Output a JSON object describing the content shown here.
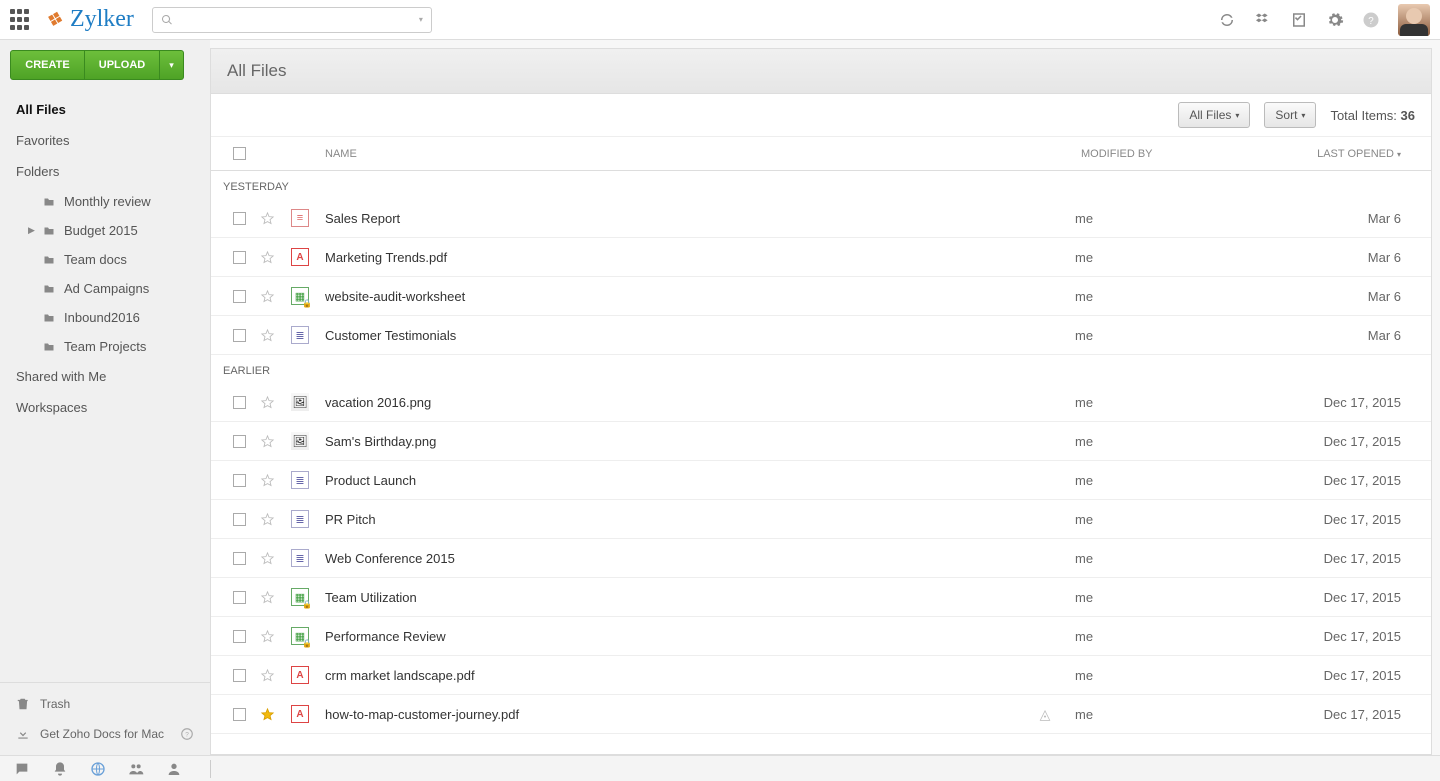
{
  "brand": {
    "name": "Zylker"
  },
  "search": {
    "placeholder": ""
  },
  "sidebar": {
    "create": "CREATE",
    "upload": "UPLOAD",
    "items": [
      {
        "label": "All Files",
        "active": true
      },
      {
        "label": "Favorites"
      },
      {
        "label": "Folders"
      }
    ],
    "folders": [
      {
        "label": "Monthly review"
      },
      {
        "label": "Budget 2015",
        "expandable": true
      },
      {
        "label": "Team docs"
      },
      {
        "label": "Ad Campaigns"
      },
      {
        "label": "Inbound2016"
      },
      {
        "label": "Team Projects"
      }
    ],
    "after": [
      {
        "label": "Shared with Me"
      },
      {
        "label": "Workspaces"
      }
    ],
    "bottom": {
      "trash": "Trash",
      "mac": "Get Zoho Docs for Mac"
    }
  },
  "main": {
    "title": "All Files",
    "toolbar": {
      "filter": "All Files",
      "sort": "Sort",
      "total_label": "Total Items:",
      "total_count": "36"
    },
    "columns": {
      "name": "NAME",
      "modified": "MODIFIED BY",
      "opened": "LAST OPENED"
    },
    "groups": [
      {
        "label": "YESTERDAY",
        "rows": [
          {
            "icon": "doc",
            "name": "Sales Report",
            "mod": "me",
            "opened": "Mar 6"
          },
          {
            "icon": "pdf",
            "name": "Marketing Trends.pdf",
            "mod": "me",
            "opened": "Mar 6"
          },
          {
            "icon": "sheetl",
            "name": "website-audit-worksheet",
            "mod": "me",
            "opened": "Mar 6"
          },
          {
            "icon": "docs",
            "name": "Customer Testimonials",
            "mod": "me",
            "opened": "Mar 6"
          }
        ]
      },
      {
        "label": "EARLIER",
        "rows": [
          {
            "icon": "img",
            "name": "vacation 2016.png",
            "mod": "me",
            "opened": "Dec 17, 2015"
          },
          {
            "icon": "img",
            "name": "Sam's Birthday.png",
            "mod": "me",
            "opened": "Dec 17, 2015"
          },
          {
            "icon": "docs",
            "name": "Product Launch",
            "mod": "me",
            "opened": "Dec 17, 2015"
          },
          {
            "icon": "docs",
            "name": "PR Pitch",
            "mod": "me",
            "opened": "Dec 17, 2015"
          },
          {
            "icon": "docs",
            "name": "Web Conference 2015",
            "mod": "me",
            "opened": "Dec 17, 2015"
          },
          {
            "icon": "sheetl",
            "name": "Team Utilization",
            "mod": "me",
            "opened": "Dec 17, 2015"
          },
          {
            "icon": "sheetl",
            "name": "Performance Review",
            "mod": "me",
            "opened": "Dec 17, 2015"
          },
          {
            "icon": "pdf",
            "name": "crm market landscape.pdf",
            "mod": "me",
            "opened": "Dec 17, 2015"
          },
          {
            "icon": "pdf",
            "name": "how-to-map-customer-journey.pdf",
            "fav": true,
            "special": true,
            "mod": "me",
            "opened": "Dec 17, 2015"
          }
        ]
      }
    ]
  }
}
